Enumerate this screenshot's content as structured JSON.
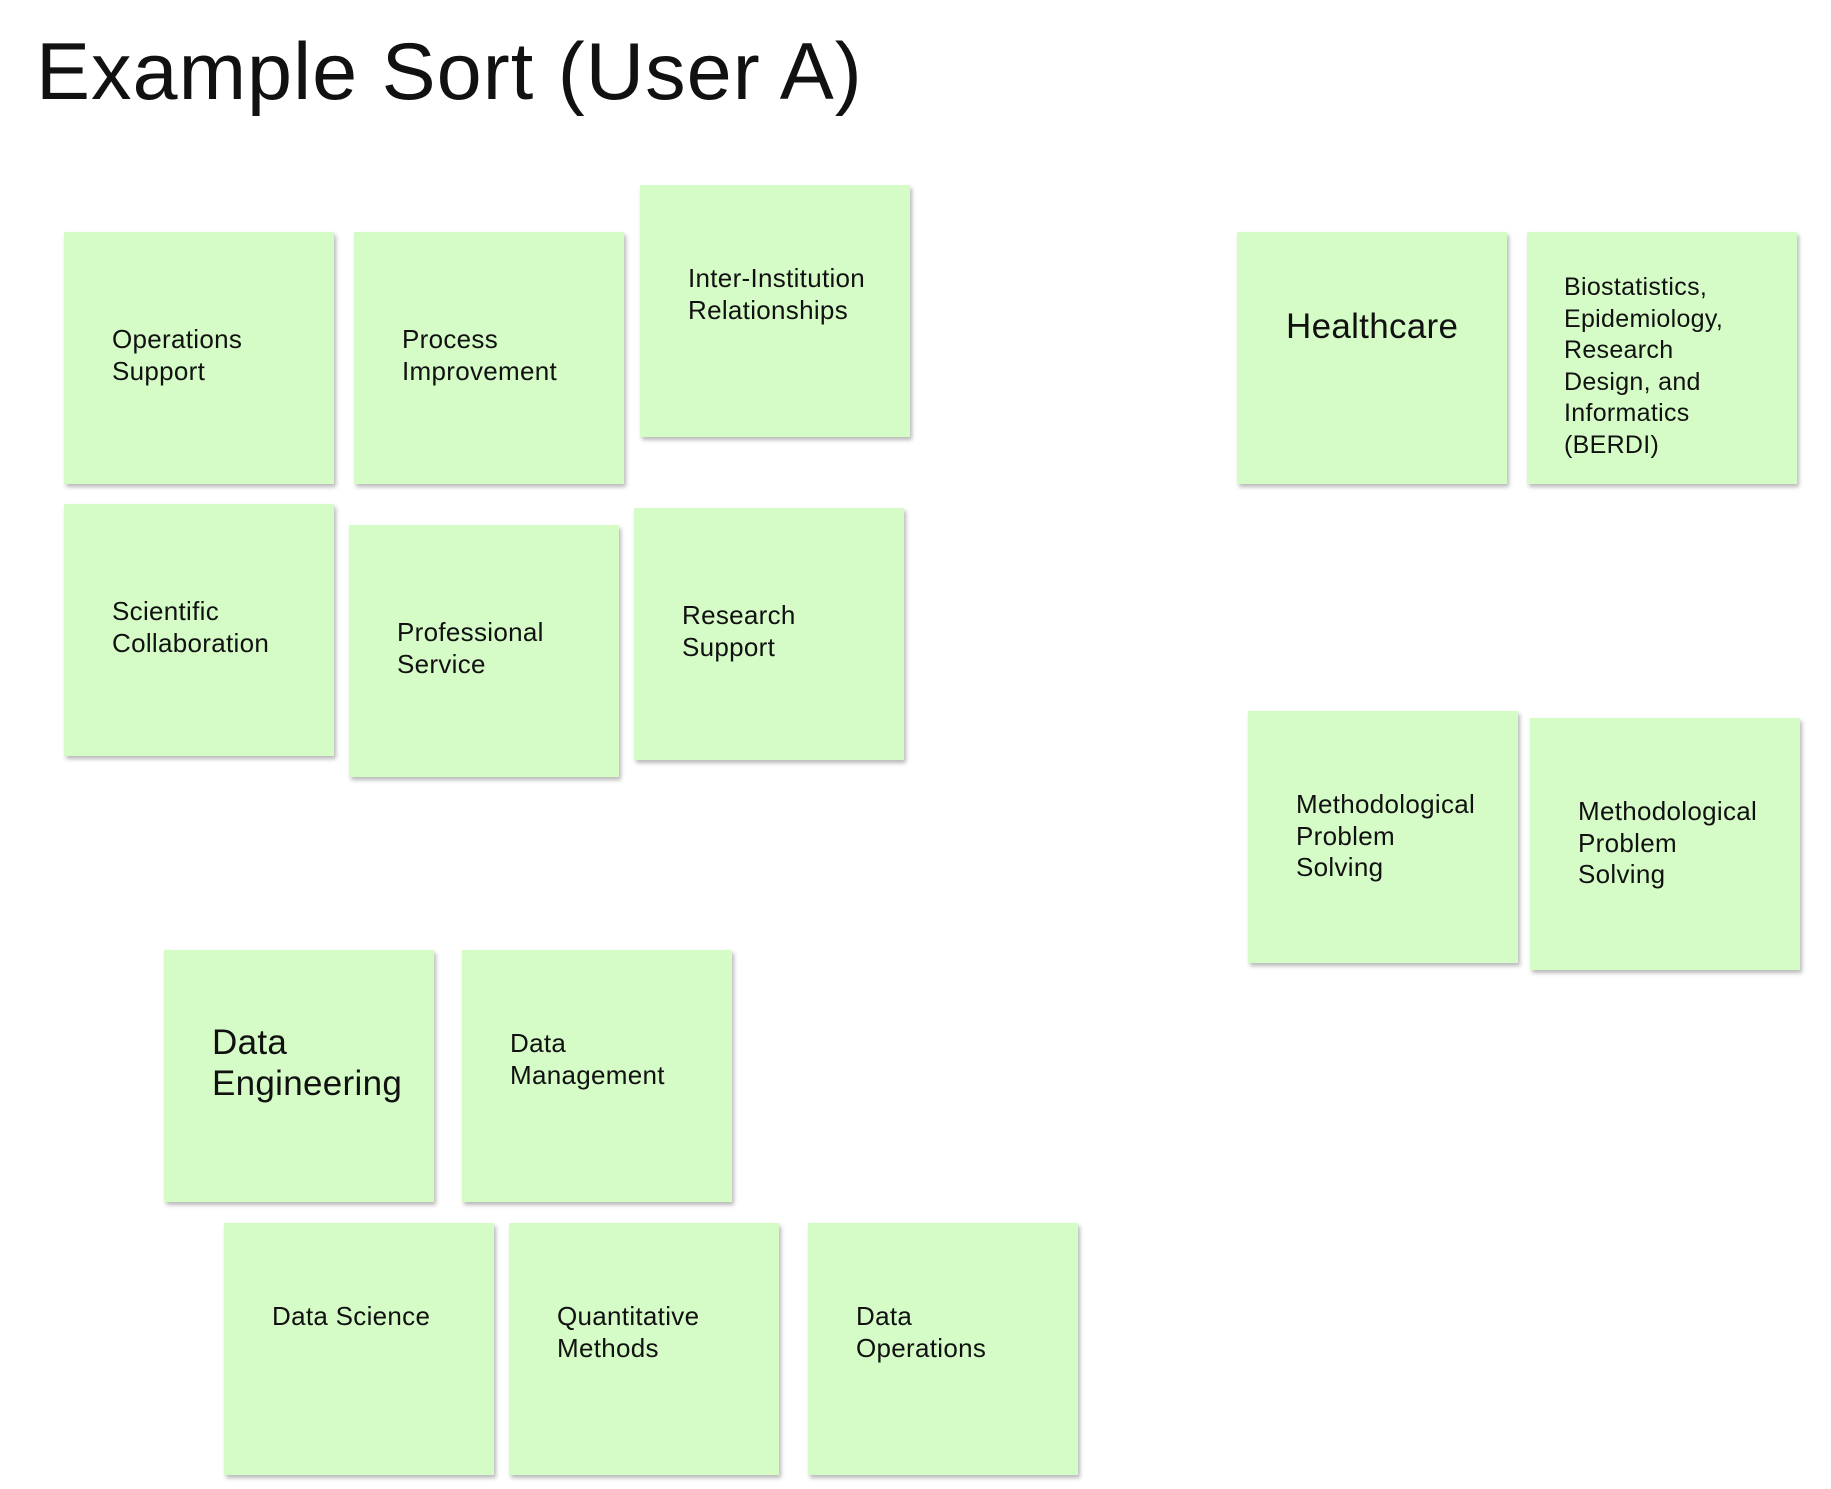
{
  "board": {
    "title": "Example Sort (User A)"
  },
  "colors": {
    "sticky_fill": "#d5fcc6",
    "background": "#ffffff",
    "text": "#111111"
  },
  "notes": [
    {
      "id": "operations-support",
      "text": "Operations\nSupport"
    },
    {
      "id": "process-improvement",
      "text": "Process\nImprovement"
    },
    {
      "id": "inter-institution",
      "text": "Inter-Institution\nRelationships"
    },
    {
      "id": "scientific-collaboration",
      "text": "Scientific\nCollaboration"
    },
    {
      "id": "professional-service",
      "text": "Professional\nService"
    },
    {
      "id": "research-support",
      "text": "Research\nSupport"
    },
    {
      "id": "healthcare",
      "text": "Healthcare"
    },
    {
      "id": "berdi",
      "text": "Biostatistics,\nEpidemiology,\nResearch\nDesign, and\nInformatics\n(BERDI)"
    },
    {
      "id": "methodological-1",
      "text": "Methodological\nProblem\nSolving"
    },
    {
      "id": "methodological-2",
      "text": "Methodological\nProblem\nSolving"
    },
    {
      "id": "data-engineering",
      "text": "Data\nEngineering"
    },
    {
      "id": "data-management",
      "text": "Data\nManagement"
    },
    {
      "id": "data-science",
      "text": "Data Science"
    },
    {
      "id": "quantitative-methods",
      "text": "Quantitative\nMethods"
    },
    {
      "id": "data-operations",
      "text": "Data\nOperations"
    }
  ]
}
